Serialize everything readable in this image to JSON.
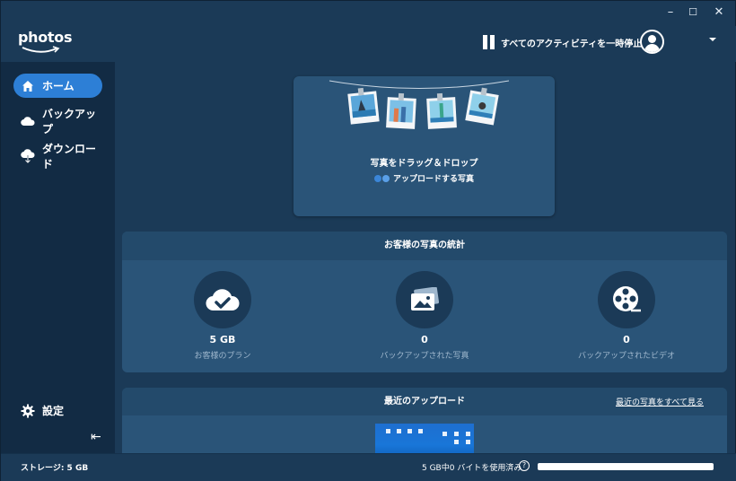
{
  "app": {
    "logo_text": "photos"
  },
  "window": {
    "minimize": "–",
    "maximize": "☐",
    "close": "✕"
  },
  "header": {
    "pause_all_label": "すべてのアクティビティを一時停止",
    "pause_icon": "pause-icon",
    "avatar_icon": "user-avatar-icon"
  },
  "sidebar": {
    "items": [
      {
        "label": "ホーム",
        "icon": "home-icon",
        "active": true
      },
      {
        "label": "バックアップ",
        "icon": "cloud-icon",
        "active": false
      },
      {
        "label": "ダウンロード",
        "icon": "cloud-download-icon",
        "active": false
      }
    ],
    "settings_label": "設定",
    "collapse_glyph": "⇤"
  },
  "dropzone": {
    "title": "写真をドラッグ＆ドロップ",
    "subtitle": "アップロードする写真"
  },
  "stats": {
    "title": "お客様の写真の統計",
    "items": [
      {
        "value": "5 GB",
        "label": "お客様のプラン",
        "icon": "cloud-check-icon"
      },
      {
        "value": "0",
        "label": "バックアップされた写真",
        "icon": "photo-icon"
      },
      {
        "value": "0",
        "label": "バックアップされたビデオ",
        "icon": "film-reel-icon"
      }
    ]
  },
  "recent": {
    "title": "最近のアップロード",
    "see_all_label": "最近の写真をすべて見る"
  },
  "statusbar": {
    "storage_label": "ストレージ: 5 GB",
    "usage_label": "5 GB中0 バイトを使用済み",
    "help_glyph": "?",
    "usage_fraction": 0.0
  },
  "colors": {
    "accent": "#2d7fd6",
    "sidebar_bg": "#122b44",
    "main_bg": "#1b3a57",
    "card_bg": "#2a5478"
  }
}
